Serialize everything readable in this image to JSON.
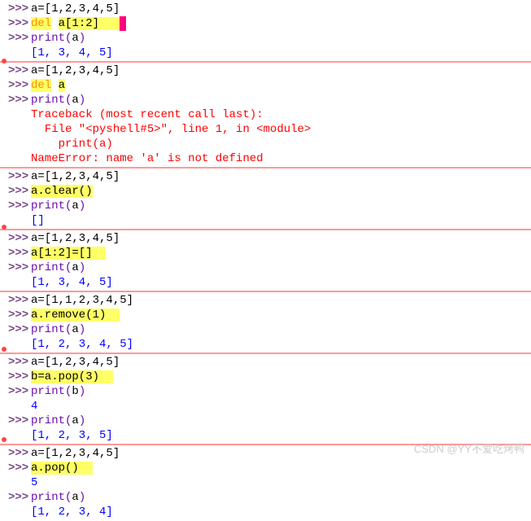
{
  "prompt": ">>>",
  "blocks": [
    {
      "lines": [
        {
          "p": true,
          "segs": [
            {
              "t": "a=[1,2,3,4,5]",
              "c": "var"
            }
          ]
        },
        {
          "p": true,
          "segs": [
            {
              "t": "del",
              "c": "kw-del"
            },
            {
              "t": " ",
              "c": "var"
            },
            {
              "t": "a[1:2]",
              "c": "hl"
            },
            {
              "t": "   ",
              "c": "hl"
            },
            {
              "t": " ",
              "c": "cursor-bar"
            }
          ]
        },
        {
          "p": true,
          "segs": [
            {
              "t": "print",
              "c": "func"
            },
            {
              "t": "(",
              "c": "paren"
            },
            {
              "t": "a",
              "c": "var"
            },
            {
              "t": ")",
              "c": "paren"
            }
          ]
        },
        {
          "p": false,
          "segs": [
            {
              "t": "[1, 3, 4, 5]",
              "c": "out-blue"
            }
          ]
        }
      ],
      "dot": true
    },
    {
      "lines": [
        {
          "p": true,
          "segs": [
            {
              "t": "a=[1,2,3,4,5]",
              "c": "var"
            }
          ]
        },
        {
          "p": true,
          "segs": [
            {
              "t": "del",
              "c": "kw-del"
            },
            {
              "t": " ",
              "c": "var"
            },
            {
              "t": "a",
              "c": "hl"
            }
          ]
        },
        {
          "p": true,
          "segs": [
            {
              "t": "print",
              "c": "func"
            },
            {
              "t": "(",
              "c": "paren"
            },
            {
              "t": "a",
              "c": "var"
            },
            {
              "t": ")",
              "c": "paren"
            }
          ]
        },
        {
          "p": false,
          "segs": [
            {
              "t": "Traceback (most recent call last):",
              "c": "err"
            }
          ]
        },
        {
          "p": false,
          "segs": [
            {
              "t": "  File \"<pyshell#5>\", line 1, in <module>",
              "c": "err"
            }
          ]
        },
        {
          "p": false,
          "segs": [
            {
              "t": "    print(a)",
              "c": "err"
            }
          ]
        },
        {
          "p": false,
          "segs": [
            {
              "t": "NameError: name 'a' is not defined",
              "c": "err"
            }
          ]
        }
      ],
      "dot": false
    },
    {
      "lines": [
        {
          "p": true,
          "segs": [
            {
              "t": "a=[1,2,3,4,5]",
              "c": "var"
            }
          ]
        },
        {
          "p": true,
          "segs": [
            {
              "t": "a.clear()",
              "c": "hl"
            }
          ]
        },
        {
          "p": true,
          "segs": [
            {
              "t": "print",
              "c": "func"
            },
            {
              "t": "(",
              "c": "paren"
            },
            {
              "t": "a",
              "c": "var"
            },
            {
              "t": ")",
              "c": "paren"
            }
          ]
        },
        {
          "p": false,
          "segs": [
            {
              "t": "[]",
              "c": "out-blue"
            }
          ]
        }
      ],
      "dot": true
    },
    {
      "lines": [
        {
          "p": true,
          "segs": [
            {
              "t": "a=[1,2,3,4,5]",
              "c": "var"
            }
          ]
        },
        {
          "p": true,
          "segs": [
            {
              "t": "a[1:2]=[]",
              "c": "hl"
            },
            {
              "t": "  ",
              "c": "hl"
            }
          ]
        },
        {
          "p": true,
          "segs": [
            {
              "t": "print",
              "c": "func"
            },
            {
              "t": "(",
              "c": "paren"
            },
            {
              "t": "a",
              "c": "var"
            },
            {
              "t": ")",
              "c": "paren"
            }
          ]
        },
        {
          "p": false,
          "segs": [
            {
              "t": "[1, 3, 4, 5]",
              "c": "out-blue"
            }
          ]
        }
      ],
      "dot": false
    },
    {
      "lines": [
        {
          "p": true,
          "segs": [
            {
              "t": "a=[1,1,2,3,4,5]",
              "c": "var"
            }
          ]
        },
        {
          "p": true,
          "segs": [
            {
              "t": "a.remove(1)",
              "c": "hl"
            },
            {
              "t": "  ",
              "c": "hl"
            }
          ]
        },
        {
          "p": true,
          "segs": [
            {
              "t": "print",
              "c": "func"
            },
            {
              "t": "(",
              "c": "paren"
            },
            {
              "t": "a",
              "c": "var"
            },
            {
              "t": ")",
              "c": "paren"
            }
          ]
        },
        {
          "p": false,
          "segs": [
            {
              "t": "[1, 2, 3, 4, 5]",
              "c": "out-blue"
            }
          ]
        }
      ],
      "dot": true
    },
    {
      "lines": [
        {
          "p": true,
          "segs": [
            {
              "t": "a=[1,2,3,4,5]",
              "c": "var"
            }
          ]
        },
        {
          "p": true,
          "segs": [
            {
              "t": "b=a.pop(3)",
              "c": "hl"
            },
            {
              "t": "  ",
              "c": "hl"
            }
          ]
        },
        {
          "p": true,
          "segs": [
            {
              "t": "print",
              "c": "func"
            },
            {
              "t": "(",
              "c": "paren"
            },
            {
              "t": "b",
              "c": "var"
            },
            {
              "t": ")",
              "c": "paren"
            }
          ]
        },
        {
          "p": false,
          "segs": [
            {
              "t": "4",
              "c": "out-blue"
            }
          ]
        },
        {
          "p": true,
          "segs": [
            {
              "t": "print",
              "c": "func"
            },
            {
              "t": "(",
              "c": "paren"
            },
            {
              "t": "a",
              "c": "var"
            },
            {
              "t": ")",
              "c": "paren"
            }
          ]
        },
        {
          "p": false,
          "segs": [
            {
              "t": "[1, 2, 3, 5]",
              "c": "out-blue"
            }
          ]
        }
      ],
      "dot": true
    },
    {
      "lines": [
        {
          "p": true,
          "segs": [
            {
              "t": "a=[1,2,3,4,5]",
              "c": "var"
            }
          ]
        },
        {
          "p": true,
          "segs": [
            {
              "t": "a.pop()",
              "c": "hl"
            },
            {
              "t": "  ",
              "c": "hl"
            }
          ]
        },
        {
          "p": false,
          "segs": [
            {
              "t": "5",
              "c": "out-blue"
            }
          ]
        },
        {
          "p": true,
          "segs": [
            {
              "t": "print",
              "c": "func"
            },
            {
              "t": "(",
              "c": "paren"
            },
            {
              "t": "a",
              "c": "var"
            },
            {
              "t": ")",
              "c": "paren"
            }
          ]
        },
        {
          "p": false,
          "segs": [
            {
              "t": "[1, 2, 3, 4]",
              "c": "out-blue"
            }
          ]
        }
      ],
      "dot": false
    }
  ],
  "watermark": "CSDN @YY不爱吃烤鸭"
}
